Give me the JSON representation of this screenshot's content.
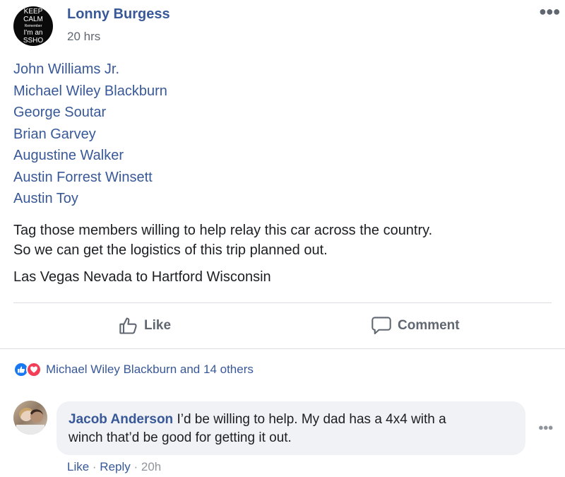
{
  "post": {
    "avatar_text": [
      "KEEP",
      "CALM",
      "Remember",
      "I'm an",
      "SSHO"
    ],
    "author": "Lonny Burgess",
    "time": "20 hrs",
    "tagged": [
      "John Williams Jr.",
      "Michael Wiley Blackburn",
      "George Soutar",
      "Brian Garvey",
      "Augustine Walker",
      "Austin Forrest Winsett",
      "Austin Toy"
    ],
    "body_line1": "Tag those members willing to help relay this car across the country.",
    "body_line2": "So we can get the logistics of this trip planned out.",
    "body_line3": "Las Vegas Nevada to Hartford Wisconsin"
  },
  "actions": {
    "like": "Like",
    "comment": "Comment"
  },
  "reactions": {
    "text": "Michael Wiley Blackburn and 14 others"
  },
  "comment": {
    "author": "Jacob Anderson",
    "text_line1": " I’d be willing to help. My dad has a 4x4 with a",
    "text_line2": "winch that’d be good for getting it out.",
    "like": "Like",
    "sep1": " · ",
    "reply": "Reply",
    "sep2": " · ",
    "time": "20h"
  },
  "colors": {
    "link": "#385898",
    "like_reaction": "#1877f2",
    "love_reaction": "#f33e58"
  },
  "icons": [
    "more-horizontal-icon",
    "thumbs-up-icon",
    "comment-bubble-icon",
    "like-reaction-icon",
    "love-reaction-icon"
  ]
}
